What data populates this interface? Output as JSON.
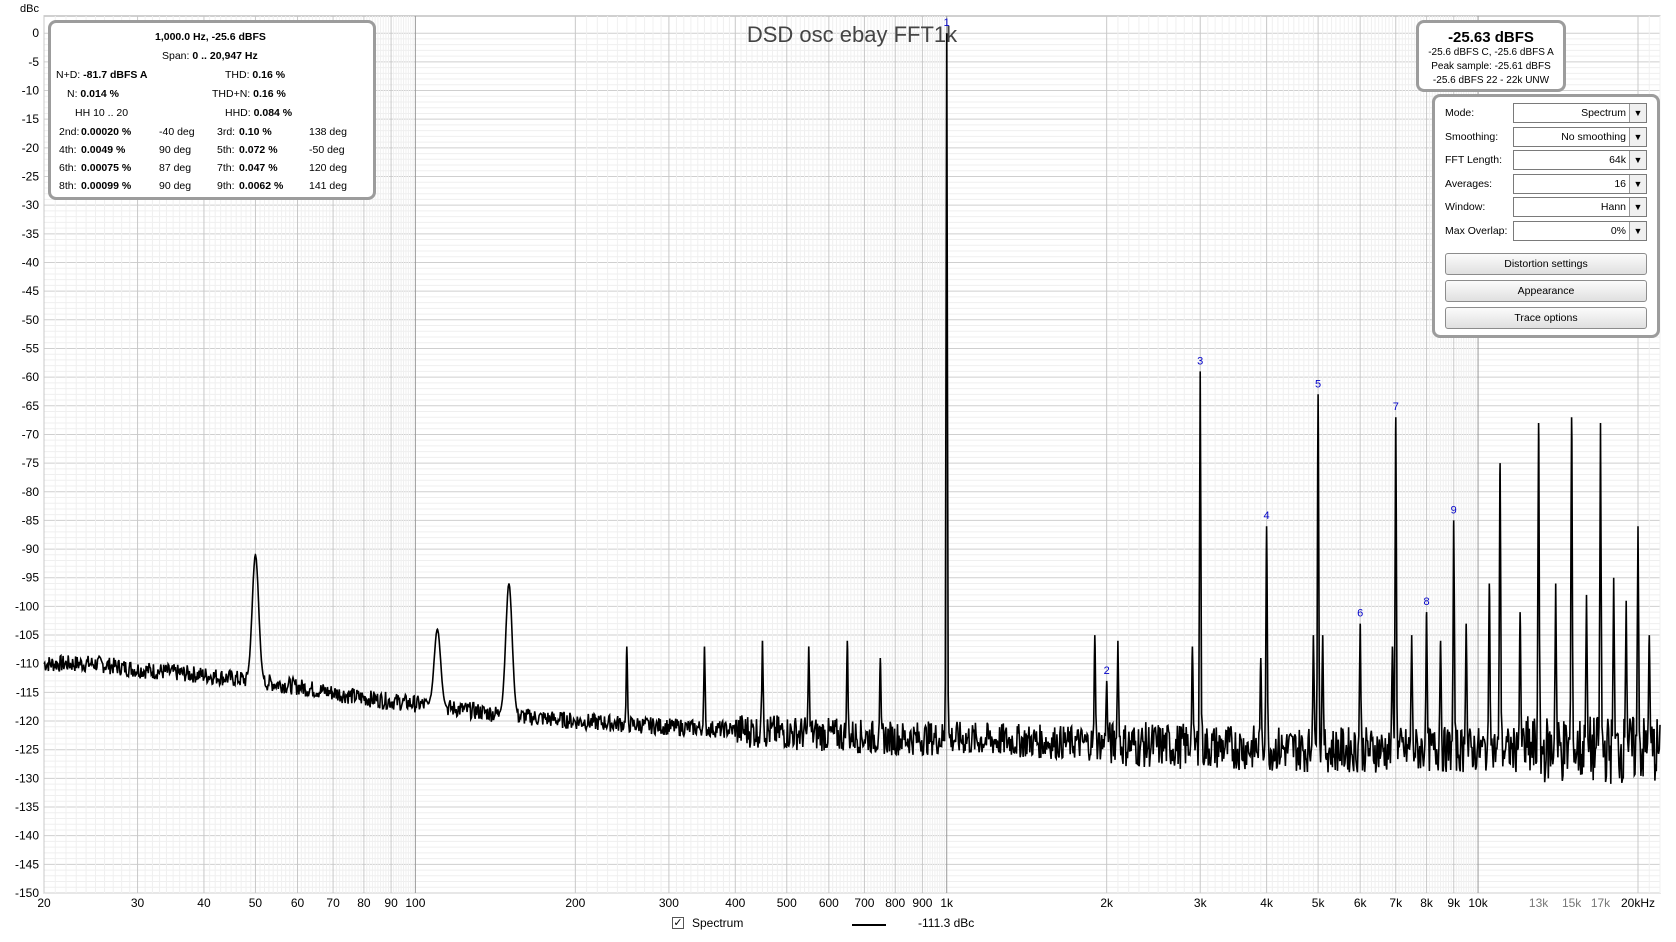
{
  "chart_data": {
    "type": "line",
    "title": "DSD osc ebay FFT1k",
    "ylabel": "dBc",
    "xscale": "log",
    "xlim": [
      20,
      22000
    ],
    "ylim": [
      -150,
      3
    ],
    "grid": true,
    "x_tick_labels": [
      {
        "x": 20,
        "label": "20"
      },
      {
        "x": 30,
        "label": "30"
      },
      {
        "x": 40,
        "label": "40"
      },
      {
        "x": 50,
        "label": "50"
      },
      {
        "x": 60,
        "label": "60"
      },
      {
        "x": 70,
        "label": "70"
      },
      {
        "x": 80,
        "label": "80"
      },
      {
        "x": 90,
        "label": "90"
      },
      {
        "x": 100,
        "label": "100"
      },
      {
        "x": 200,
        "label": "200"
      },
      {
        "x": 300,
        "label": "300"
      },
      {
        "x": 400,
        "label": "400"
      },
      {
        "x": 500,
        "label": "500"
      },
      {
        "x": 600,
        "label": "600"
      },
      {
        "x": 700,
        "label": "700"
      },
      {
        "x": 800,
        "label": "800"
      },
      {
        "x": 900,
        "label": "900"
      },
      {
        "x": 1000,
        "label": "1k"
      },
      {
        "x": 2000,
        "label": "2k"
      },
      {
        "x": 3000,
        "label": "3k"
      },
      {
        "x": 4000,
        "label": "4k"
      },
      {
        "x": 5000,
        "label": "5k"
      },
      {
        "x": 6000,
        "label": "6k"
      },
      {
        "x": 7000,
        "label": "7k"
      },
      {
        "x": 8000,
        "label": "8k"
      },
      {
        "x": 9000,
        "label": "9k"
      },
      {
        "x": 10000,
        "label": "10k"
      },
      {
        "x": 13000,
        "label": "13k"
      },
      {
        "x": 15000,
        "label": "15k"
      },
      {
        "x": 17000,
        "label": "17k"
      },
      {
        "x": 20000,
        "label": "20kHz"
      }
    ],
    "y_ticks": [
      0,
      -5,
      -10,
      -15,
      -20,
      -25,
      -30,
      -35,
      -40,
      -45,
      -50,
      -55,
      -60,
      -65,
      -70,
      -75,
      -80,
      -85,
      -90,
      -95,
      -100,
      -105,
      -110,
      -115,
      -120,
      -125,
      -130,
      -135,
      -140,
      -145,
      -150
    ],
    "series": [
      {
        "name": "Spectrum",
        "color": "#000000",
        "noise_floor": [
          [
            20,
            -110
          ],
          [
            25,
            -110
          ],
          [
            30,
            -111
          ],
          [
            40,
            -112
          ],
          [
            50,
            -113
          ],
          [
            60,
            -114
          ],
          [
            80,
            -116
          ],
          [
            100,
            -117
          ],
          [
            150,
            -119
          ],
          [
            200,
            -120
          ],
          [
            300,
            -121
          ],
          [
            500,
            -122
          ],
          [
            800,
            -123
          ],
          [
            1000,
            -123
          ],
          [
            2000,
            -124
          ],
          [
            5000,
            -125
          ],
          [
            10000,
            -125
          ],
          [
            20000,
            -125
          ],
          [
            22000,
            -125
          ]
        ],
        "peaks": [
          {
            "x": 50,
            "y": -91
          },
          {
            "x": 110,
            "y": -104
          },
          {
            "x": 150,
            "y": -96
          },
          {
            "x": 250,
            "y": -107
          },
          {
            "x": 350,
            "y": -107
          },
          {
            "x": 450,
            "y": -106
          },
          {
            "x": 550,
            "y": -107
          },
          {
            "x": 650,
            "y": -106
          },
          {
            "x": 750,
            "y": -109
          },
          {
            "x": 1000,
            "y": 0
          },
          {
            "x": 1900,
            "y": -105
          },
          {
            "x": 2000,
            "y": -113
          },
          {
            "x": 2100,
            "y": -106
          },
          {
            "x": 2900,
            "y": -107
          },
          {
            "x": 3000,
            "y": -59
          },
          {
            "x": 3900,
            "y": -109
          },
          {
            "x": 4000,
            "y": -86
          },
          {
            "x": 4900,
            "y": -105
          },
          {
            "x": 5000,
            "y": -63
          },
          {
            "x": 5100,
            "y": -105
          },
          {
            "x": 6000,
            "y": -103
          },
          {
            "x": 6900,
            "y": -107
          },
          {
            "x": 7000,
            "y": -67
          },
          {
            "x": 7500,
            "y": -105
          },
          {
            "x": 8000,
            "y": -101
          },
          {
            "x": 8500,
            "y": -106
          },
          {
            "x": 9000,
            "y": -85
          },
          {
            "x": 9500,
            "y": -103
          },
          {
            "x": 10500,
            "y": -96
          },
          {
            "x": 11000,
            "y": -75
          },
          {
            "x": 12000,
            "y": -101
          },
          {
            "x": 13000,
            "y": -68
          },
          {
            "x": 14000,
            "y": -96
          },
          {
            "x": 15000,
            "y": -67
          },
          {
            "x": 16000,
            "y": -98
          },
          {
            "x": 17000,
            "y": -68
          },
          {
            "x": 18000,
            "y": -95
          },
          {
            "x": 19000,
            "y": -99
          },
          {
            "x": 20000,
            "y": -86
          },
          {
            "x": 21000,
            "y": -105
          }
        ]
      }
    ],
    "harmonic_markers": [
      {
        "label": "1",
        "x": 1000,
        "y": 0
      },
      {
        "label": "2",
        "x": 2000,
        "y": -113
      },
      {
        "label": "3",
        "x": 3000,
        "y": -59
      },
      {
        "label": "4",
        "x": 4000,
        "y": -86
      },
      {
        "label": "5",
        "x": 5000,
        "y": -63
      },
      {
        "label": "6",
        "x": 6000,
        "y": -103
      },
      {
        "label": "7",
        "x": 7000,
        "y": -67
      },
      {
        "label": "8",
        "x": 8000,
        "y": -101
      },
      {
        "label": "9",
        "x": 9000,
        "y": -85
      }
    ],
    "marker_color": "#0000c8"
  },
  "distortion_panel": {
    "freq_level": "1,000.0 Hz, -25.6 dBFS",
    "span_label": "Span:",
    "span_value": "0 .. 20,947 Hz",
    "nd_label": "N+D:",
    "nd_value": "-81.7 dBFS A",
    "thd_label": "THD:",
    "thd_value": "0.16 %",
    "n_label": "N:",
    "n_value": "0.014 %",
    "thdn_label": "THD+N:",
    "thdn_value": "0.16 %",
    "hh_label": "HH 10 .. 20",
    "hhd_label": "HHD:",
    "hhd_value": "0.084 %",
    "rows": [
      {
        "l_label": "2nd:",
        "l_value": "0.00020 %",
        "l_deg": "-40 deg",
        "r_label": "3rd:",
        "r_value": "0.10 %",
        "r_deg": "138 deg"
      },
      {
        "l_label": "4th:",
        "l_value": "0.0049 %",
        "l_deg": "90 deg",
        "r_label": "5th:",
        "r_value": "0.072 %",
        "r_deg": "-50 deg"
      },
      {
        "l_label": "6th:",
        "l_value": "0.00075 %",
        "l_deg": "87 deg",
        "r_label": "7th:",
        "r_value": "0.047 %",
        "r_deg": "120 deg"
      },
      {
        "l_label": "8th:",
        "l_value": "0.00099 %",
        "l_deg": "90 deg",
        "r_label": "9th:",
        "r_value": "0.0062 %",
        "r_deg": "141 deg"
      }
    ]
  },
  "level_panel": {
    "main": "-25.63 dBFS",
    "line1": "-25.6 dBFS C, -25.6 dBFS A",
    "line2": "Peak sample: -25.61 dBFS",
    "line3": "-25.6 dBFS 22 - 22k UNW"
  },
  "settings": {
    "rows": [
      {
        "label": "Mode:",
        "value": "Spectrum"
      },
      {
        "label": "Smoothing:",
        "value": "No  smoothing"
      },
      {
        "label": "FFT Length:",
        "value": "64k"
      },
      {
        "label": "Averages:",
        "value": "16"
      },
      {
        "label": "Window:",
        "value": "Hann"
      },
      {
        "label": "Max Overlap:",
        "value": "0%"
      }
    ],
    "dropdown_icon": "chevron-down-icon",
    "distortion_button": "Distortion settings",
    "appearance_button": "Appearance",
    "trace_button": "Trace options"
  },
  "legend": {
    "checkbox_mark": "✓",
    "label": "Spectrum",
    "value": "-111.3 dBc"
  }
}
